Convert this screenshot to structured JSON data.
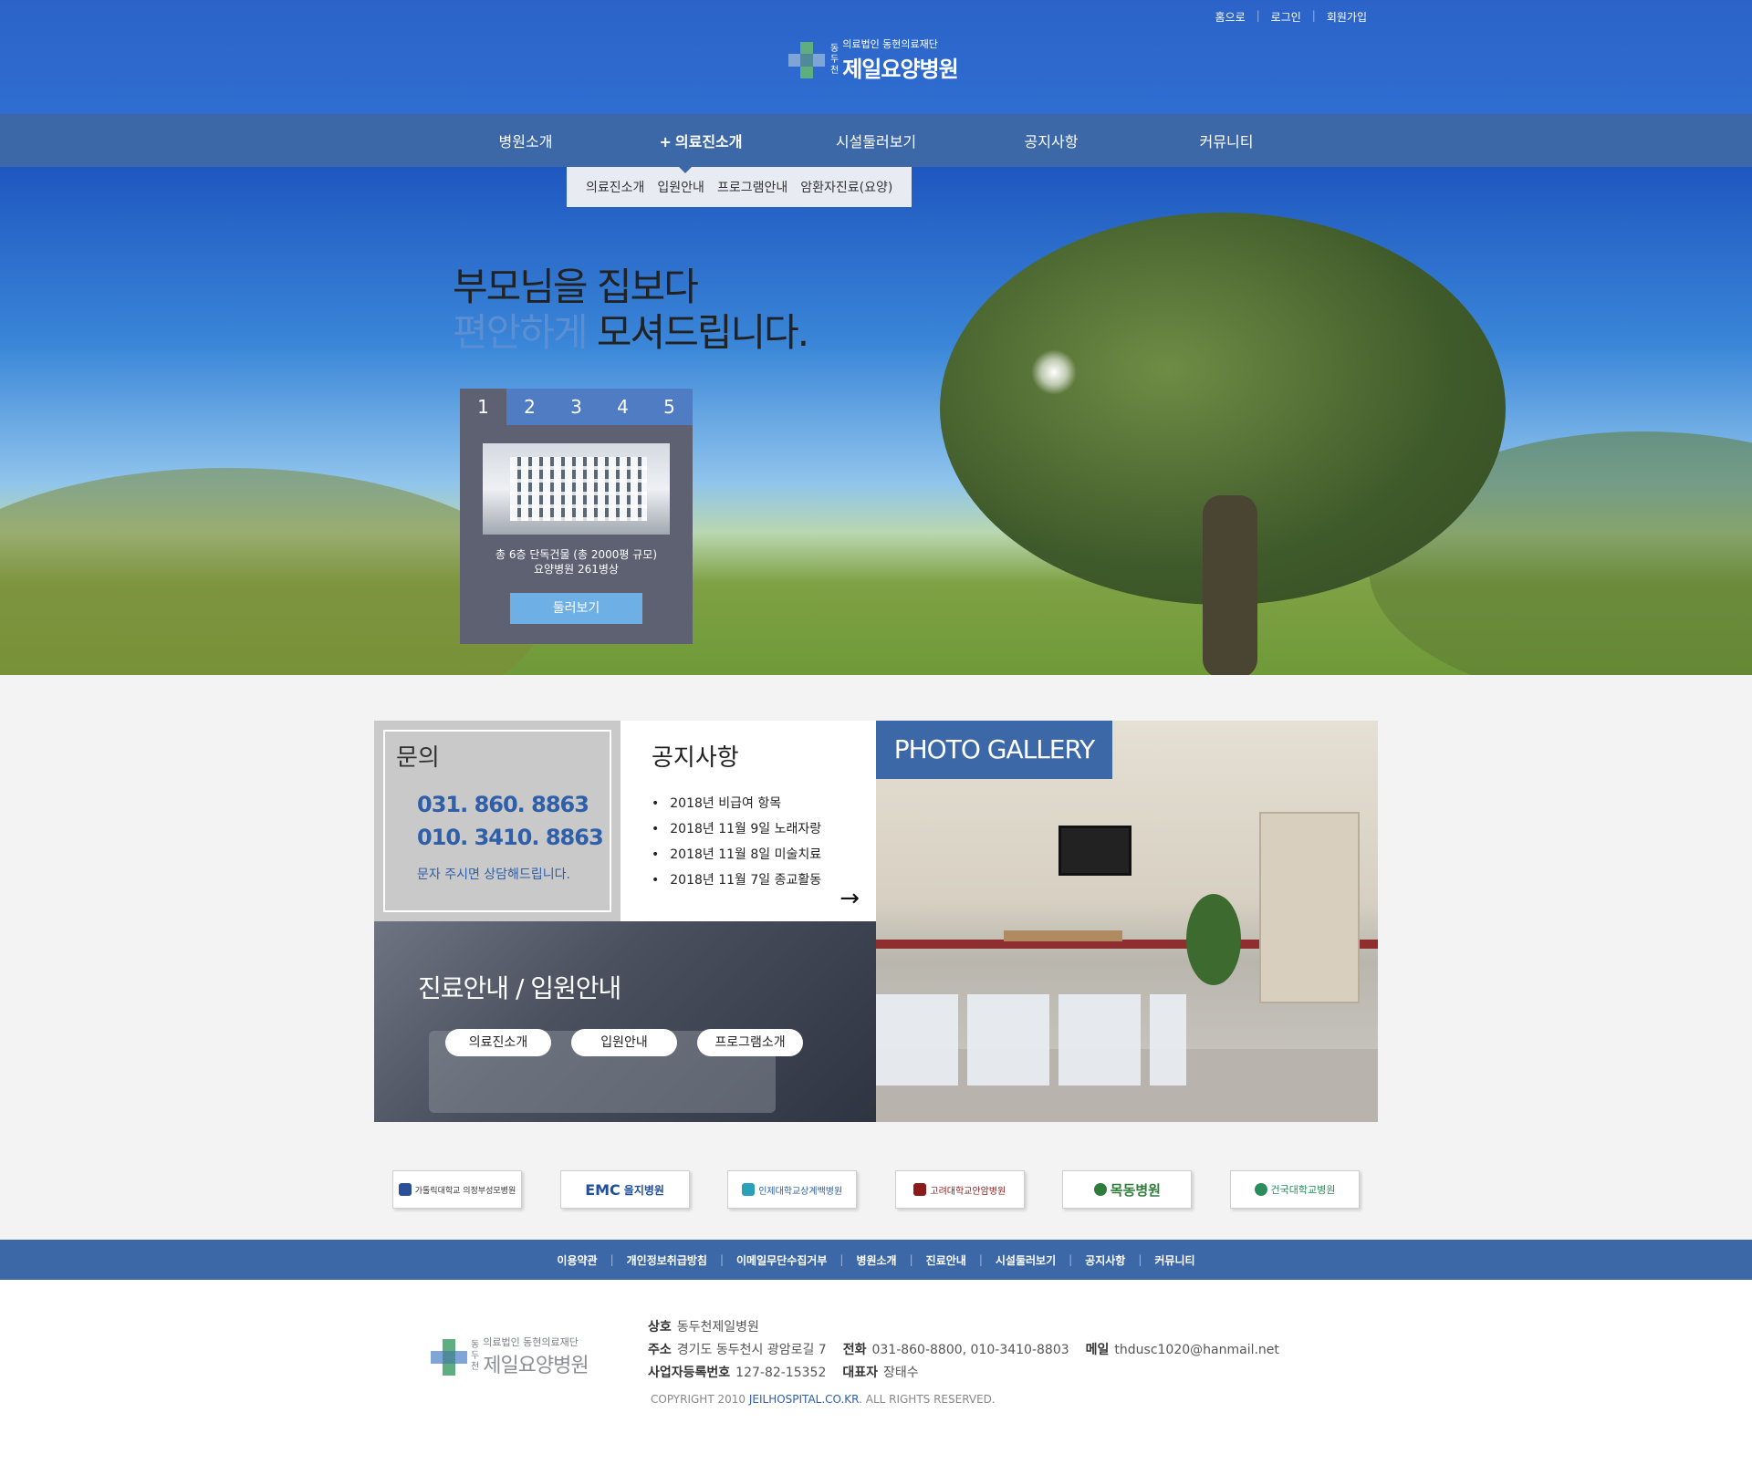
{
  "header": {
    "util_links": [
      "홈으로",
      "로그인",
      "회원가입"
    ],
    "logo": {
      "vertical_chars": [
        "동",
        "두",
        "천"
      ],
      "sub": "의료법인 동현의료재단",
      "name": "제일요양병원"
    }
  },
  "gnb": {
    "items": [
      "병원소개",
      "의료진소개",
      "시설둘러보기",
      "공지사항",
      "커뮤니티"
    ],
    "active_index": 1,
    "active_prefix": "+"
  },
  "submenu": {
    "items": [
      "의료진소개",
      "입원안내",
      "프로그램안내",
      "암환자진료(요양)"
    ]
  },
  "hero": {
    "slogan_line1": "부모님을 집보다",
    "slogan_line2_light": "편안하게",
    "slogan_line2_rest": "모셔드립니다."
  },
  "slider": {
    "tabs": [
      "1",
      "2",
      "3",
      "4",
      "5"
    ],
    "active_tab": 0,
    "desc_line1": "총 6층 단독건물 (총 2000평 규모)",
    "desc_line2": "요양병원 261병상",
    "button": "둘러보기"
  },
  "contact": {
    "title": "문의",
    "tel1": "031. 860. 8863",
    "tel2": "010. 3410. 8863",
    "note": "문자 주시면 상담해드립니다."
  },
  "notice": {
    "title": "공지사항",
    "items": [
      "2018년 비급여 항목",
      "2018년 11월 9일 노래자랑",
      "2018년 11월 8일 미술치료",
      "2018년 11월 7일 종교활동"
    ],
    "more_icon": "arrow-right-icon"
  },
  "gallery": {
    "label": "PHOTO GALLERY"
  },
  "care": {
    "title": "진료안내 / 입원안내",
    "buttons": [
      "의료진소개",
      "입원안내",
      "프로그램소개"
    ]
  },
  "partners": [
    {
      "name": "가톨릭대학교 의정부성모병원",
      "color": "#2a4e9a"
    },
    {
      "name": "을지병원",
      "prefix": "EMC",
      "color": "#1f4fa0"
    },
    {
      "name": "인제대학교상계백병원",
      "color": "#2aa1b8"
    },
    {
      "name": "고려대학교안암병원",
      "color": "#8b1a1a"
    },
    {
      "name": "목동병원",
      "color": "#2f7d3a"
    },
    {
      "name": "건국대학교병원",
      "color": "#2a8b5c"
    }
  ],
  "footer_nav": [
    "이용약관",
    "개인정보취급방침",
    "이메일무단수집거부",
    "병원소개",
    "진료안내",
    "시설둘러보기",
    "공지사항",
    "커뮤니티"
  ],
  "footer": {
    "company_label": "상호",
    "company": "동두천제일병원",
    "address_label": "주소",
    "address": "경기도 동두천시 광암로길 7",
    "phone_label": "전화",
    "phone": "031-860-8800, 010-3410-8803",
    "mail_label": "메일",
    "mail": "thdusc1020@hanmail.net",
    "biz_label": "사업자등록번호",
    "biz": "127-82-15352",
    "ceo_label": "대표자",
    "ceo": "장태수",
    "copy_prefix": "COPYRIGHT 2010",
    "copy_link": "JEILHOSPITAL.CO.KR",
    "copy_suffix": "ALL RIGHTS RESERVED."
  },
  "colors": {
    "header_blue": "#2f6ed0",
    "nav_blue": "#3c68a8",
    "accent_blue": "#2f5fa8",
    "button_light_blue": "#6eb0e6"
  }
}
